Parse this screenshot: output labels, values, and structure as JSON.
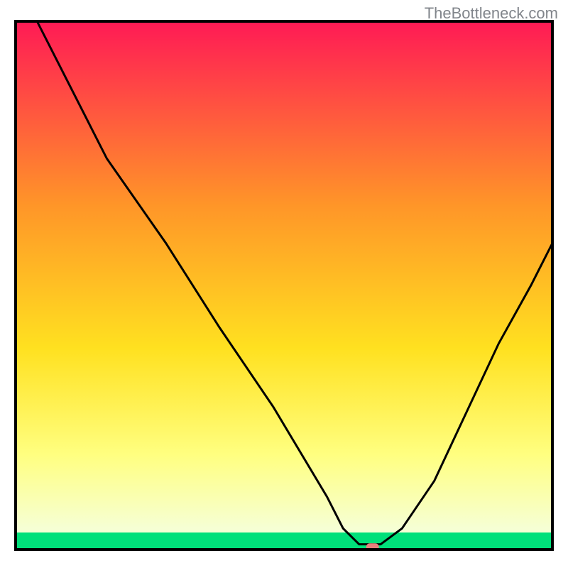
{
  "watermark": "TheBottleneck.com",
  "chart_data": {
    "type": "line",
    "title": "",
    "xlabel": "",
    "ylabel": "",
    "xlim": [
      0,
      100
    ],
    "ylim": [
      0,
      100
    ],
    "gradient_colors": {
      "top": "#ff1a55",
      "mid1": "#ff9628",
      "mid2": "#ffe120",
      "mid3": "#ffff80",
      "bottom_band": "#00e07a"
    },
    "series": [
      {
        "name": "curve",
        "x": [
          4,
          10,
          17,
          28,
          38,
          48,
          58,
          61,
          64,
          68,
          72,
          78,
          84,
          90,
          96,
          100
        ],
        "y": [
          100,
          88,
          74,
          58,
          42,
          27,
          10,
          4,
          1,
          1,
          4,
          13,
          26,
          39,
          50,
          58
        ]
      }
    ],
    "marker": {
      "x": 66.5,
      "y": 0.5,
      "color": "#e77f7c"
    }
  }
}
